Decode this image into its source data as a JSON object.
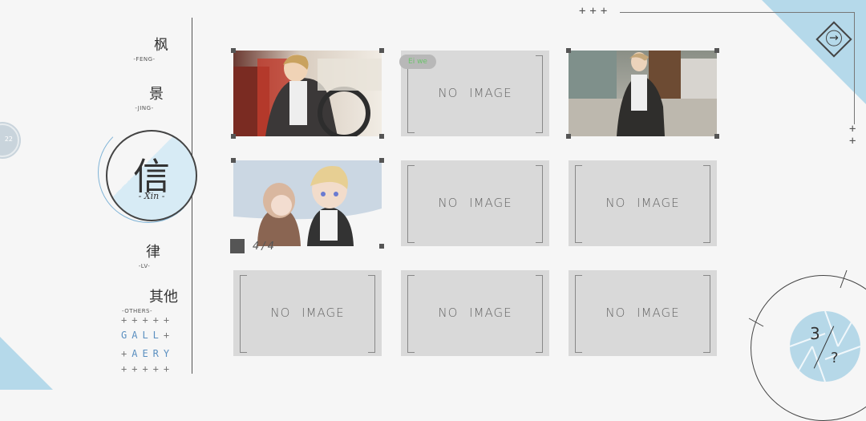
{
  "nav": {
    "items": [
      {
        "zh": "枫",
        "en": "-FENG-"
      },
      {
        "zh": "景",
        "en": "-JING-"
      },
      {
        "zh": "律",
        "en": "-LV-"
      },
      {
        "zh": "其他",
        "en": "-OTHERS-"
      }
    ],
    "active": {
      "zh": "信",
      "en": "- Xin -"
    },
    "gallery_line1": "GALL",
    "gallery_line2": "AERY",
    "plus_row": "+++++",
    "plus_single": "+"
  },
  "side_bubble": {
    "label": "22"
  },
  "grid": {
    "no_image_label": "NO  IMAGE",
    "badge_text": "Ei we",
    "counter": "4/4",
    "cards": [
      {
        "type": "image",
        "subject": "man-driving-car"
      },
      {
        "type": "empty",
        "badge": true
      },
      {
        "type": "image",
        "subject": "man-in-living-room"
      },
      {
        "type": "image",
        "subject": "chibi-couple"
      },
      {
        "type": "empty"
      },
      {
        "type": "empty"
      },
      {
        "type": "empty"
      },
      {
        "type": "empty"
      },
      {
        "type": "empty"
      }
    ]
  },
  "decor": {
    "top_plus": "+++",
    "right_plus_1": "+",
    "right_plus_2": "+"
  },
  "next_button": {
    "icon": "arrow-right-icon"
  },
  "pager": {
    "current": "3",
    "total": "?"
  },
  "colors": {
    "accent_blue": "#b5d9ea",
    "gallery_blue": "#5a8fc0",
    "card_bg": "#d9d9d9"
  }
}
